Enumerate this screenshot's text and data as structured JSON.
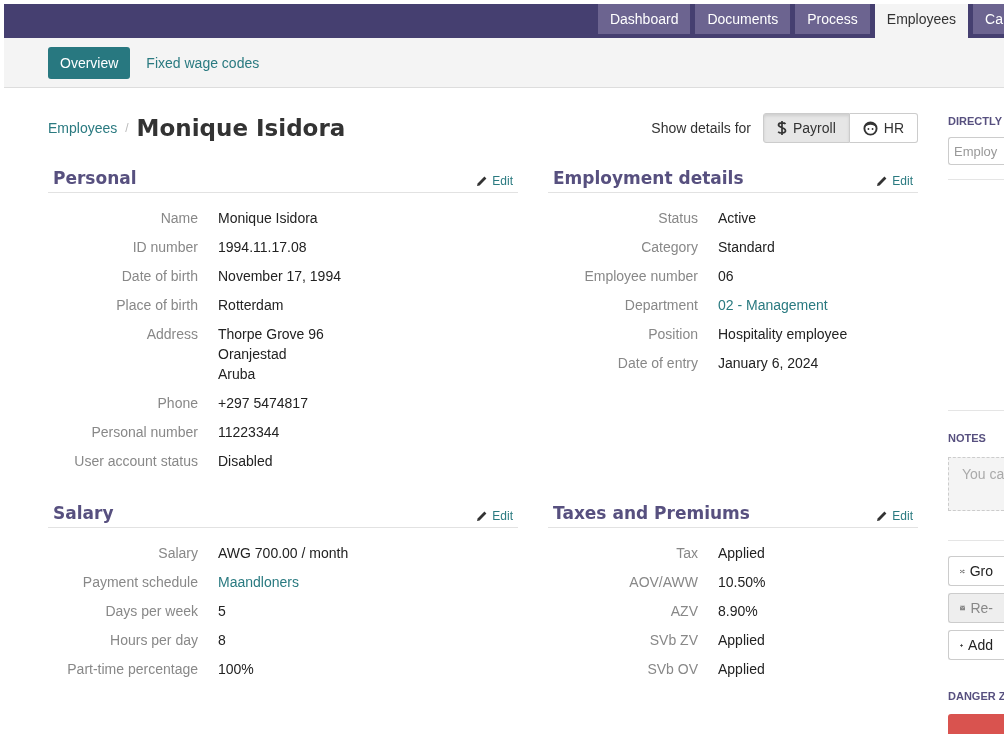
{
  "top_nav": {
    "tabs": [
      {
        "label": "Dashboard",
        "selected": false
      },
      {
        "label": "Documents",
        "selected": false
      },
      {
        "label": "Process",
        "selected": false
      },
      {
        "label": "Employees",
        "selected": true
      },
      {
        "label": "Ca",
        "selected": false
      }
    ]
  },
  "sub_nav": {
    "items": [
      {
        "label": "Overview",
        "selected": true
      },
      {
        "label": "Fixed wage codes",
        "selected": false
      }
    ]
  },
  "breadcrumb": {
    "parent": "Employees",
    "separator": "/",
    "title": "Monique Isidora"
  },
  "details_toggle": {
    "label": "Show details for",
    "options": [
      {
        "label": "Payroll",
        "kind": "dollar",
        "selected": true
      },
      {
        "label": "HR",
        "kind": "face",
        "selected": false
      }
    ]
  },
  "sections": [
    {
      "title": "Personal",
      "edit": "Edit",
      "rows": [
        {
          "label": "Name",
          "lines": [
            "Monique Isidora"
          ],
          "kind": "text"
        },
        {
          "label": "ID number",
          "lines": [
            "1994.11.17.08"
          ],
          "kind": "text"
        },
        {
          "label": "Date of birth",
          "lines": [
            "November 17, 1994"
          ],
          "kind": "text"
        },
        {
          "label": "Place of birth",
          "lines": [
            "Rotterdam"
          ],
          "kind": "text"
        },
        {
          "label": "Address",
          "lines": [
            "Thorpe Grove 96",
            "Oranjestad",
            "Aruba"
          ],
          "kind": "text"
        },
        {
          "label": "Phone",
          "lines": [
            "+297 5474817"
          ],
          "kind": "text"
        },
        {
          "label": "Personal number",
          "lines": [
            "11223344"
          ],
          "kind": "text"
        },
        {
          "label": "User account status",
          "lines": [
            "Disabled"
          ],
          "kind": "text"
        }
      ]
    },
    {
      "title": "Employment details",
      "edit": "Edit",
      "rows": [
        {
          "label": "Status",
          "lines": [
            "Active"
          ],
          "kind": "text"
        },
        {
          "label": "Category",
          "lines": [
            "Standard"
          ],
          "kind": "text"
        },
        {
          "label": "Employee number",
          "lines": [
            "06"
          ],
          "kind": "text"
        },
        {
          "label": "Department",
          "lines": [
            "02 - Management"
          ],
          "kind": "link"
        },
        {
          "label": "Position",
          "lines": [
            "Hospitality employee"
          ],
          "kind": "text"
        },
        {
          "label": "Date of entry",
          "lines": [
            "January 6, 2024"
          ],
          "kind": "text"
        }
      ]
    },
    {
      "title": "Salary",
      "edit": "Edit",
      "rows": [
        {
          "label": "Salary",
          "lines": [
            "AWG 700.00 / month"
          ],
          "kind": "text"
        },
        {
          "label": "Payment schedule",
          "lines": [
            "Maandloners"
          ],
          "kind": "link"
        },
        {
          "label": "Days per week",
          "lines": [
            "5"
          ],
          "kind": "text"
        },
        {
          "label": "Hours per day",
          "lines": [
            "8"
          ],
          "kind": "text"
        },
        {
          "label": "Part-time percentage",
          "lines": [
            "100%"
          ],
          "kind": "text"
        }
      ]
    },
    {
      "title": "Taxes and Premiums",
      "edit": "Edit",
      "rows": [
        {
          "label": "Tax",
          "lines": [
            "Applied"
          ],
          "kind": "text"
        },
        {
          "label": "AOV/AWW",
          "lines": [
            "10.50%"
          ],
          "kind": "text"
        },
        {
          "label": "AZV",
          "lines": [
            "8.90%"
          ],
          "kind": "text"
        },
        {
          "label": "SVb ZV",
          "lines": [
            "Applied"
          ],
          "kind": "text"
        },
        {
          "label": "SVb OV",
          "lines": [
            "Applied"
          ],
          "kind": "text"
        }
      ]
    }
  ],
  "sidebar": {
    "directly_heading": "DIRECTLY",
    "search_placeholder": "Employ",
    "notes_heading": "NOTES",
    "notes_placeholder": "You ca",
    "actions": [
      {
        "label": "Gro",
        "kind": "shuffle",
        "disabled": false
      },
      {
        "label": "Re-",
        "kind": "envelope",
        "disabled": true
      },
      {
        "label": "Add",
        "kind": "plus",
        "disabled": false
      }
    ],
    "danger_heading": "DANGER Z"
  }
}
